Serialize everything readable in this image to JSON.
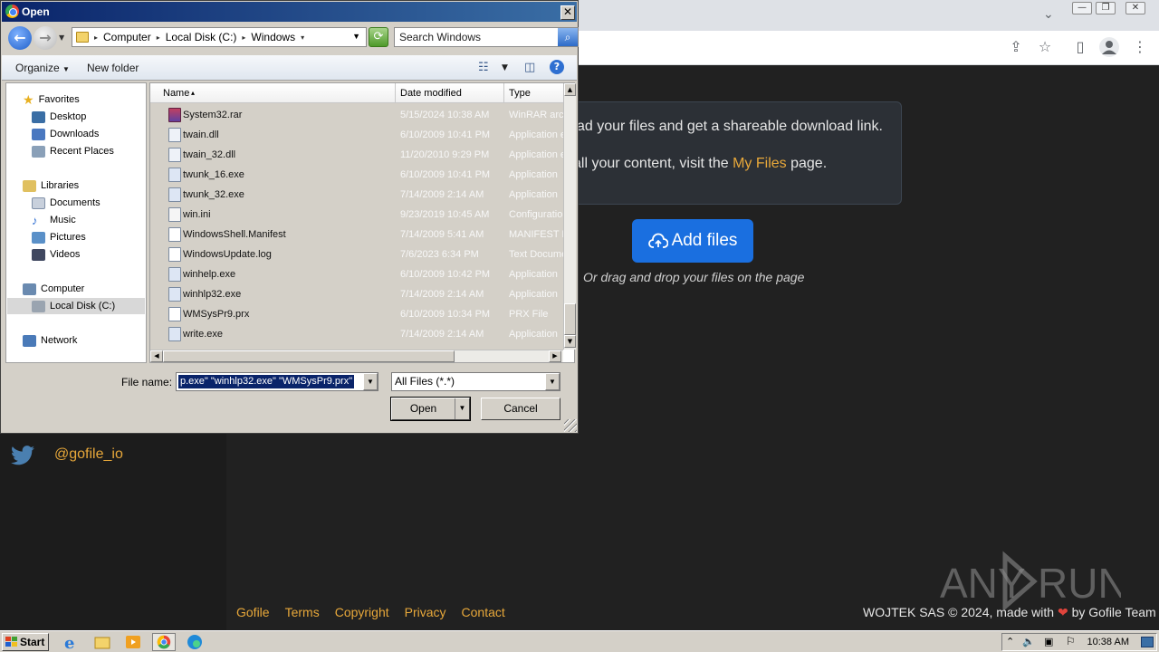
{
  "browser": {
    "window_controls": [
      "—",
      "❐",
      "✕"
    ]
  },
  "page": {
    "info_line1": "ad your files and get a shareable download link.",
    "info_line2_prefix": "all your content, visit the ",
    "info_line2_link": "My Files",
    "info_line2_suffix": " page.",
    "add_files_label": "Add files",
    "drag_text": "Or drag and drop your files on the page",
    "twitter_handle": "@gofile_io",
    "footer_links": [
      "Gofile",
      "Terms",
      "Copyright",
      "Privacy",
      "Contact"
    ],
    "footer_right_prefix": "WOJTEK SAS © 2024, made with ",
    "footer_right_suffix": " by Gofile Team",
    "watermark": "ANY RUN"
  },
  "dialog": {
    "title": "Open",
    "breadcrumb": [
      "Computer",
      "Local Disk (C:)",
      "Windows"
    ],
    "search_placeholder": "Search Windows",
    "organize_label": "Organize",
    "new_folder_label": "New folder",
    "nav": {
      "favorites": "Favorites",
      "desktop": "Desktop",
      "downloads": "Downloads",
      "recent": "Recent Places",
      "libraries": "Libraries",
      "documents": "Documents",
      "music": "Music",
      "pictures": "Pictures",
      "videos": "Videos",
      "computer": "Computer",
      "local_disk": "Local Disk (C:)",
      "network": "Network"
    },
    "columns": {
      "name": "Name",
      "date": "Date modified",
      "type": "Type"
    },
    "files": [
      {
        "name": "System32.rar",
        "date": "5/15/2024 10:38 AM",
        "type": "WinRAR arc"
      },
      {
        "name": "twain.dll",
        "date": "6/10/2009 10:41 PM",
        "type": "Application e"
      },
      {
        "name": "twain_32.dll",
        "date": "11/20/2010 9:29 PM",
        "type": "Application e"
      },
      {
        "name": "twunk_16.exe",
        "date": "6/10/2009 10:41 PM",
        "type": "Application"
      },
      {
        "name": "twunk_32.exe",
        "date": "7/14/2009 2:14 AM",
        "type": "Application"
      },
      {
        "name": "win.ini",
        "date": "9/23/2019 10:45 AM",
        "type": "Configuratio"
      },
      {
        "name": "WindowsShell.Manifest",
        "date": "7/14/2009 5:41 AM",
        "type": "MANIFEST F"
      },
      {
        "name": "WindowsUpdate.log",
        "date": "7/6/2023 6:34 PM",
        "type": "Text Docume"
      },
      {
        "name": "winhelp.exe",
        "date": "6/10/2009 10:42 PM",
        "type": "Application"
      },
      {
        "name": "winhlp32.exe",
        "date": "7/14/2009 2:14 AM",
        "type": "Application"
      },
      {
        "name": "WMSysPr9.prx",
        "date": "6/10/2009 10:34 PM",
        "type": "PRX File"
      },
      {
        "name": "write.exe",
        "date": "7/14/2009 2:14 AM",
        "type": "Application"
      }
    ],
    "file_name_label": "File name:",
    "file_name_value": "p.exe\" \"winhlp32.exe\" \"WMSysPr9.prx\"",
    "filter_value": "All Files (*.*)",
    "open_label": "Open",
    "cancel_label": "Cancel"
  },
  "taskbar": {
    "start_label": "Start",
    "clock": "10:38 AM"
  }
}
